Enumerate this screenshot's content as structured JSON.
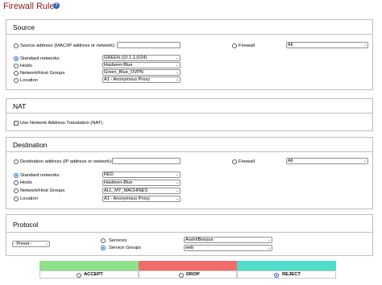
{
  "page": {
    "title": "Firewall Rules",
    "help_icon": "question-circle-icon"
  },
  "source": {
    "heading": "Source",
    "address_label": "Source address (MAC/IP address or network):",
    "address_value": "",
    "firewall_label": "Firewall",
    "firewall_value": "All",
    "standard_networks_label": "Standard networks:",
    "standard_networks_value": "GREEN (10.1.1.0/24)",
    "hosts_label": "Hosts",
    "hosts_value": "Hasbeen-Blue",
    "groups_label": "Network/Host Groups",
    "groups_value": "Green_Blue_OVPN",
    "location_label": "Location",
    "location_value": "A1 - Anonymous Proxy"
  },
  "nat": {
    "heading": "NAT",
    "checkbox_label": "Use Network Address Translation (NAT)"
  },
  "destination": {
    "heading": "Destination",
    "address_label": "Destination address (IP address or network):",
    "address_value": "",
    "firewall_label": "Firewall",
    "firewall_value": "All",
    "standard_networks_label": "Standard networks:",
    "standard_networks_value": "RED",
    "hosts_label": "Hosts",
    "hosts_value": "Hasbeen-Blue",
    "groups_label": "Network/Host Groups",
    "groups_value": "ALL_MY_MACHINES",
    "location_label": "Location",
    "location_value": "A1 - Anonymous Proxy"
  },
  "protocol": {
    "heading": "Protocol",
    "preset_value": "- Preset -",
    "services_label": "Services",
    "services_value": "Avahi/Bonjour",
    "service_groups_label": "Service Groups",
    "service_groups_value": "web"
  },
  "actions": {
    "accept_label": "ACCEPT",
    "drop_label": "DROP",
    "reject_label": "REJECT",
    "accept_color": "#8fe08a",
    "drop_color": "#f16b6b",
    "reject_color": "#4fdccb",
    "selected": "REJECT"
  }
}
